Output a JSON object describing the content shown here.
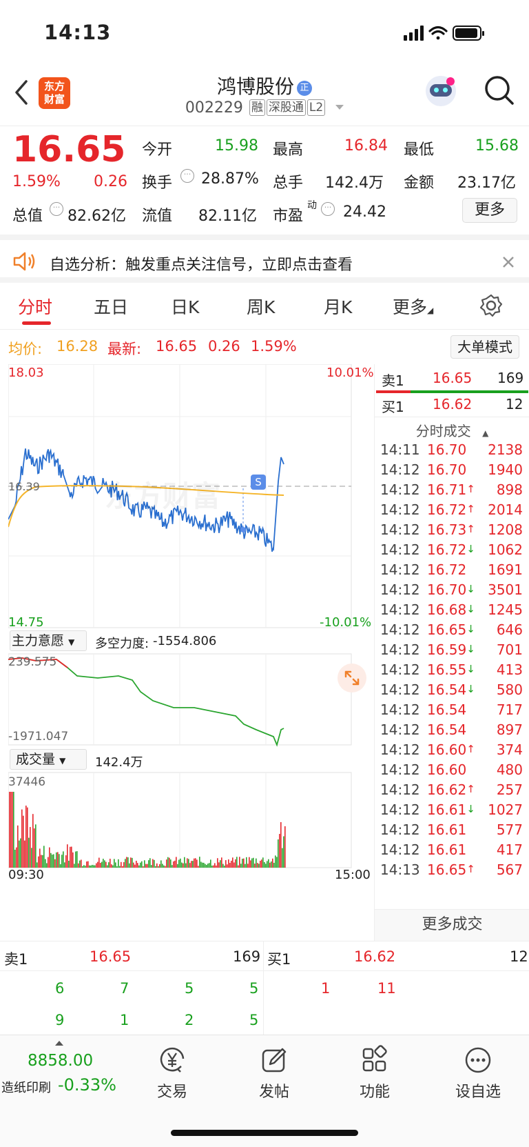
{
  "status_bar": {
    "time": "14:13"
  },
  "header": {
    "logo_line1": "东方",
    "logo_line2": "财富",
    "stock_name": "鸿博股份",
    "stock_code": "002229",
    "tags": [
      "融",
      "深股通",
      "L2"
    ]
  },
  "quote": {
    "price": "16.65",
    "pct": "1.59%",
    "change": "0.26",
    "open_label": "今开",
    "open": "15.98",
    "high_label": "最高",
    "high": "16.84",
    "low_label": "最低",
    "low": "15.68",
    "turnover_label": "换手",
    "turnover": "28.87%",
    "volume_label": "总手",
    "volume": "142.4万",
    "amount_label": "金额",
    "amount": "23.17亿",
    "mcap_label": "总值",
    "mcap": "82.62亿",
    "float_label": "流值",
    "float_cap": "82.11亿",
    "pe_label": "市盈",
    "pe_sup": "动",
    "pe": "24.42",
    "more_label": "更多"
  },
  "notice": {
    "text": "自选分析：触发重点关注信号，立即点击查看"
  },
  "tabs": [
    "分时",
    "五日",
    "日K",
    "周K",
    "月K",
    "更多"
  ],
  "info_bar": {
    "avg_label": "均价:",
    "avg": "16.28",
    "latest_label": "最新:",
    "latest": "16.65",
    "chg": "0.26",
    "pct": "1.59%",
    "mode_button": "大单模式"
  },
  "price_chart": {
    "ymax": "18.03",
    "ymin": "14.75",
    "pct_max": "10.01%",
    "pct_min": "-10.01%",
    "ref": "16.39",
    "marker": "S",
    "watermark": "东方财富"
  },
  "fund_panel": {
    "select": "主力意愿",
    "metric_label": "多空力度:",
    "metric": "-1554.806",
    "ymax": "239.575",
    "ymin": "-1971.047"
  },
  "volume_panel": {
    "select": "成交量",
    "total": "142.4万",
    "ymax": "37446",
    "start_time": "09:30",
    "end_time": "15:00"
  },
  "colors": {
    "up": "#e5262b",
    "down": "#19a01e",
    "avg": "#f5b52a",
    "price_line": "#2a6fcf"
  },
  "right_panel": {
    "ask": {
      "label": "卖1",
      "price": "16.65",
      "vol": "169"
    },
    "bid": {
      "label": "买1",
      "price": "16.62",
      "vol": "12"
    },
    "header": "分时成交",
    "trades": [
      [
        "14:11",
        "16.70",
        "2138",
        ""
      ],
      [
        "14:12",
        "16.70",
        "1940",
        ""
      ],
      [
        "14:12",
        "16.71",
        "898",
        "↑"
      ],
      [
        "14:12",
        "16.72",
        "2014",
        "↑"
      ],
      [
        "14:12",
        "16.73",
        "1208",
        "↑"
      ],
      [
        "14:12",
        "16.72",
        "1062",
        "↓"
      ],
      [
        "14:12",
        "16.72",
        "1691",
        ""
      ],
      [
        "14:12",
        "16.70",
        "3501",
        "↓"
      ],
      [
        "14:12",
        "16.68",
        "1245",
        "↓"
      ],
      [
        "14:12",
        "16.65",
        "646",
        "↓"
      ],
      [
        "14:12",
        "16.59",
        "701",
        "↓"
      ],
      [
        "14:12",
        "16.55",
        "413",
        "↓"
      ],
      [
        "14:12",
        "16.54",
        "580",
        "↓"
      ],
      [
        "14:12",
        "16.54",
        "717",
        ""
      ],
      [
        "14:12",
        "16.54",
        "897",
        ""
      ],
      [
        "14:12",
        "16.60",
        "374",
        "↑"
      ],
      [
        "14:12",
        "16.60",
        "480",
        ""
      ],
      [
        "14:12",
        "16.62",
        "257",
        "↑"
      ],
      [
        "14:12",
        "16.61",
        "1027",
        "↓"
      ],
      [
        "14:12",
        "16.61",
        "577",
        ""
      ],
      [
        "14:12",
        "16.61",
        "417",
        ""
      ],
      [
        "14:13",
        "16.65",
        "567",
        "↑"
      ]
    ],
    "more_trades": "更多成交"
  },
  "order_book": {
    "sell_label": "卖1",
    "sell_price": "16.65",
    "sell_vol": "169",
    "buy_label": "买1",
    "buy_price": "16.62",
    "buy_vol": "12",
    "sell_queue_row1": [
      "6",
      "7",
      "5",
      "5"
    ],
    "sell_queue_row2": [
      "9",
      "1",
      "2",
      "5"
    ],
    "buy_queue_row1": [
      "1",
      "11"
    ]
  },
  "bottom_nav": {
    "index_value": "8858.00",
    "index_name": "造纸印刷",
    "index_pct": "-0.33%",
    "items": [
      {
        "label": "交易",
        "icon": "yen-icon"
      },
      {
        "label": "发帖",
        "icon": "edit-icon"
      },
      {
        "label": "功能",
        "icon": "grid-icon"
      },
      {
        "label": "设自选",
        "icon": "more-dots-icon"
      }
    ]
  }
}
